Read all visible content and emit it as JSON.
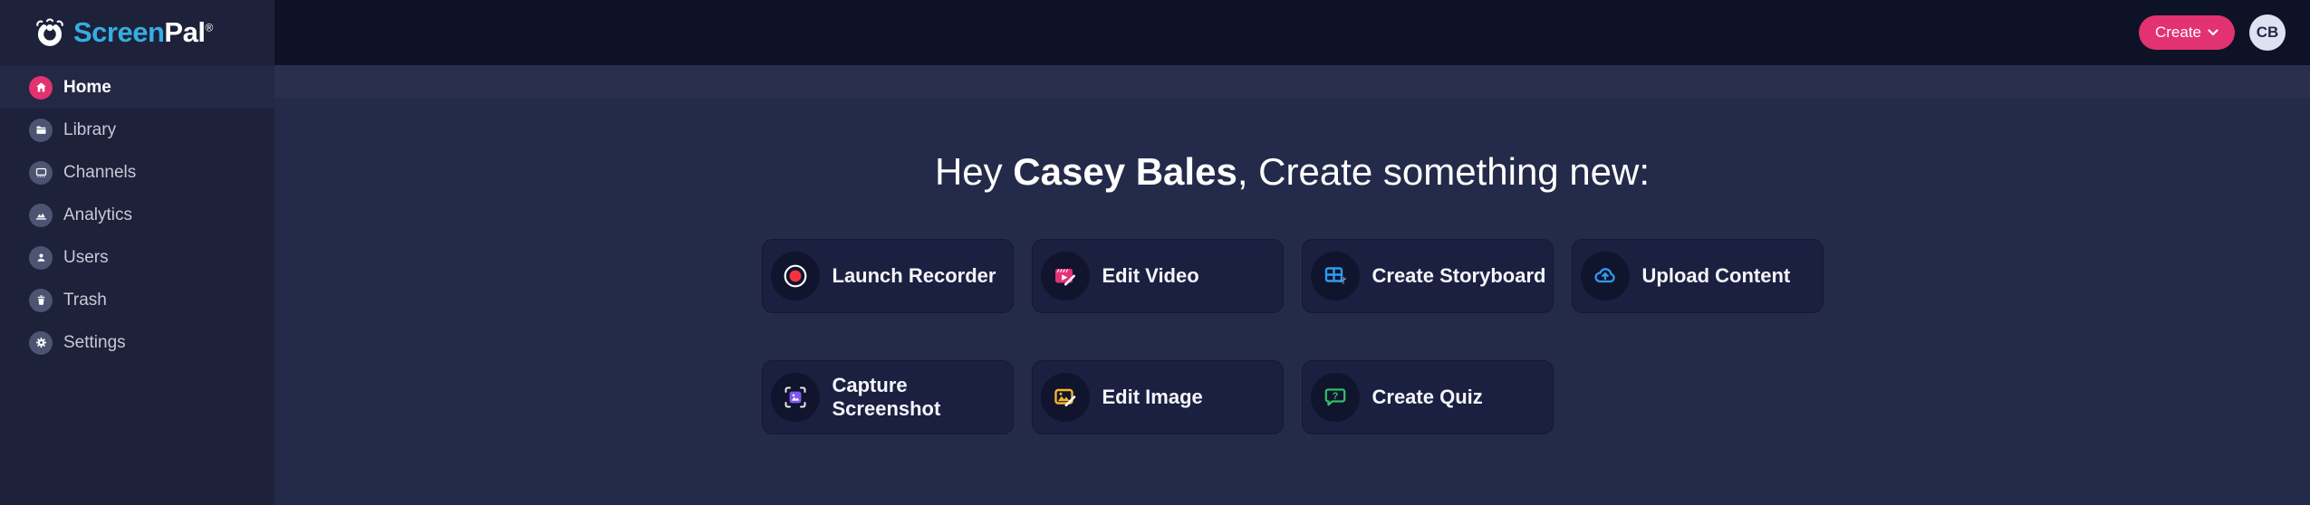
{
  "brand": {
    "icon": "screenpal-mascot-icon",
    "name_primary": "Screen",
    "name_secondary": "Pal",
    "registered_mark": "®"
  },
  "topbar": {
    "create_button": {
      "label": "Create",
      "icon": "chevron-down-icon"
    },
    "avatar": {
      "initials": "CB"
    }
  },
  "sidebar": {
    "items": [
      {
        "label": "Home",
        "icon": "home-icon",
        "active": true
      },
      {
        "label": "Library",
        "icon": "folder-icon",
        "active": false
      },
      {
        "label": "Channels",
        "icon": "monitor-icon",
        "active": false
      },
      {
        "label": "Analytics",
        "icon": "chart-icon",
        "active": false
      },
      {
        "label": "Users",
        "icon": "person-icon",
        "active": false
      },
      {
        "label": "Trash",
        "icon": "trash-icon",
        "active": false
      },
      {
        "label": "Settings",
        "icon": "gear-icon",
        "active": false
      }
    ]
  },
  "main": {
    "greeting": {
      "prefix": "Hey ",
      "name": "Casey Bales",
      "suffix": ", Create something new:"
    },
    "cards": [
      {
        "label": "Launch Recorder",
        "icon": "record-icon"
      },
      {
        "label": "Edit Video",
        "icon": "edit-video-icon"
      },
      {
        "label": "Create Storyboard",
        "icon": "storyboard-grid-icon"
      },
      {
        "label": "Upload Content",
        "icon": "cloud-upload-icon"
      },
      {
        "label": "Capture Screenshot",
        "icon": "capture-screenshot-icon"
      },
      {
        "label": "Edit Image",
        "icon": "edit-image-icon"
      },
      {
        "label": "Create Quiz",
        "icon": "quiz-bubble-icon"
      }
    ]
  },
  "colors": {
    "accent_pink": "#e2326f",
    "logo_blue": "#35aee1",
    "record_red": "#f5333f",
    "storyboard_blue": "#2f9bf0",
    "screenshot_purple": "#7e57f0",
    "image_yellow": "#f5b52e",
    "quiz_green": "#2fbe68",
    "topbar_bg": "#0e1226",
    "sidebar_bg": "#1d2139",
    "main_bg": "#242a49",
    "card_bg": "#1b2041"
  }
}
